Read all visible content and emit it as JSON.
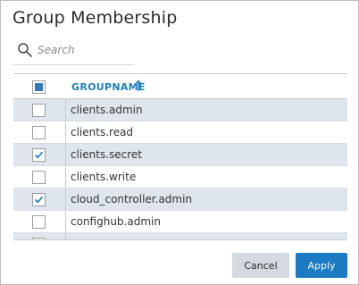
{
  "dialog": {
    "title": "Group Membership"
  },
  "search": {
    "placeholder": "Search",
    "value": "",
    "icon": "search-icon"
  },
  "table": {
    "header": {
      "column_label": "GROUPNAME",
      "sort_direction": "ascending",
      "select_all_state": "partial"
    },
    "rows": [
      {
        "name": "clients.admin",
        "checked": false
      },
      {
        "name": "clients.read",
        "checked": false
      },
      {
        "name": "clients.secret",
        "checked": true
      },
      {
        "name": "clients.write",
        "checked": false
      },
      {
        "name": "cloud_controller.admin",
        "checked": true
      },
      {
        "name": "confighub.admin",
        "checked": false
      }
    ]
  },
  "buttons": {
    "cancel_label": "Cancel",
    "apply_label": "Apply"
  },
  "colors": {
    "accent": "#1b7ac2",
    "header_text": "#1f7fb8",
    "row_alt": "#dfe5ec",
    "cancel_bg": "#d4dae0"
  }
}
